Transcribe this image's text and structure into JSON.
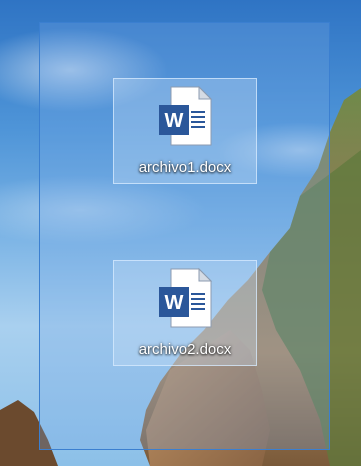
{
  "desktop": {
    "icons": [
      {
        "label": "archivo1.docx",
        "type": "word-document-icon",
        "selected": true
      },
      {
        "label": "archivo2.docx",
        "type": "word-document-icon",
        "selected": true
      }
    ],
    "colors": {
      "word_blue": "#2b579a",
      "selection_border": "#3b7fd0"
    }
  }
}
